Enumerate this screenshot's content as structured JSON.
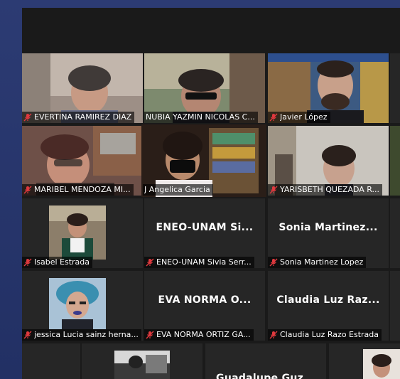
{
  "participants": [
    {
      "name": "EVERTINA RAMIREZ DIAZ"
    },
    {
      "name": "NUBIA YAZMIN NICOLAS C..."
    },
    {
      "name": "Javier López"
    },
    {
      "name": "MARIBEL MENDOZA MI..."
    },
    {
      "name": "J Angelica Garcia"
    },
    {
      "name": "YARISBETH QUEZADA R..."
    },
    {
      "name": "Isabel Estrada"
    },
    {
      "name": "ENEO-UNAM Sivia Serr...",
      "display": "ENEO-UNAM  Si..."
    },
    {
      "name": "Sonia Martinez Lopez",
      "display": "Sonia  Martinez..."
    },
    {
      "name": "jessica Lucia sainz herna..."
    },
    {
      "name": "EVA NORMA ORTIZ GA...",
      "display": "EVA NORMA O..."
    },
    {
      "name": "Claudia Luz Razo Estrada",
      "display": "Claudia Luz Raz..."
    },
    {
      "display": "Guadalupe  Guz..."
    }
  ],
  "colors": {
    "active_speaker_border": "#b9d84b",
    "muted_icon": "#e0393e",
    "tile_bg": "#262626",
    "window_bg": "#1a1a1a",
    "desktop_bg": "#2b3a6e"
  }
}
